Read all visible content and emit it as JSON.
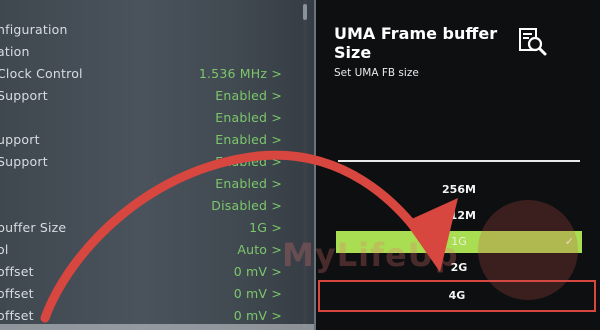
{
  "settings_list": [
    {
      "label": "nfiguration",
      "value": ""
    },
    {
      "label": "ation",
      "value": ""
    },
    {
      "label": "Clock Control",
      "value": "1.536 MHz >"
    },
    {
      "label": "Support",
      "value": "Enabled >"
    },
    {
      "label": "",
      "value": "Enabled >"
    },
    {
      "label": "upport",
      "value": "Enabled >"
    },
    {
      "label": "Support",
      "value": "Enabled >"
    },
    {
      "label": "",
      "value": "Enabled >"
    },
    {
      "label": "",
      "value": "Disabled >"
    },
    {
      "label": "buffer Size",
      "value": "1G >"
    },
    {
      "label": "ol",
      "value": "Auto >"
    },
    {
      "label": "offset",
      "value": "0 mV >"
    },
    {
      "label": "offset",
      "value": "0 mV >"
    },
    {
      "label": "offset",
      "value": "0 mV >"
    }
  ],
  "help": {
    "title": "UMA Frame buffer Size",
    "subtitle": "Set UMA FB size",
    "icon": "search-document-icon"
  },
  "options": [
    {
      "label": "256M",
      "state": "normal"
    },
    {
      "label": "512M",
      "state": "normal"
    },
    {
      "label": "1G",
      "state": "selected"
    },
    {
      "label": "2G",
      "state": "normal"
    },
    {
      "label": "4G",
      "state": "highlighted"
    }
  ],
  "watermark": "MyLifeUp",
  "colors": {
    "value_green": "#7cc76c",
    "selected_bg": "#a9dd52",
    "annotation_red": "#d7473f",
    "panel_bg": "#0d0f11"
  }
}
